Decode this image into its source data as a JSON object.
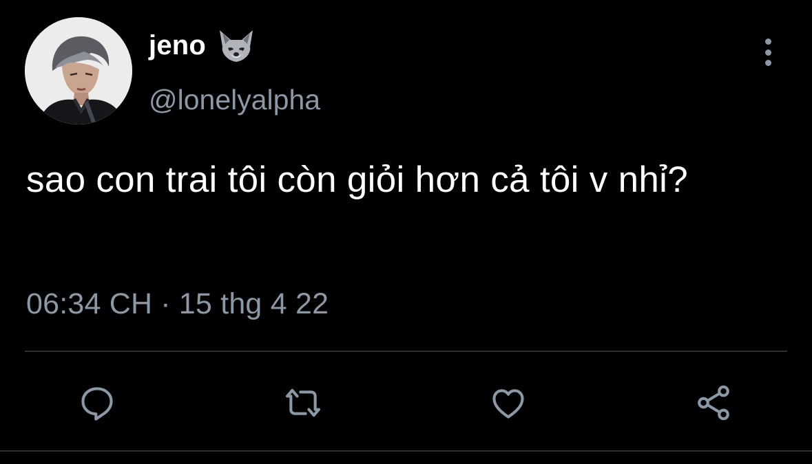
{
  "author": {
    "display_name": "jeno",
    "emoji": "wolf-emoji",
    "handle": "@lonelyalpha",
    "avatar": "profile-photo"
  },
  "tweet": {
    "text": "sao con trai tôi còn giỏi hơn cả tôi v nhỉ?",
    "time": "06:34 CH",
    "separator": "·",
    "date": "15 thg 4 22"
  },
  "actions": {
    "reply": "reply-icon",
    "retweet": "retweet-icon",
    "like": "heart-icon",
    "share": "share-icon",
    "more": "more-vertical-icon"
  },
  "colors": {
    "background": "#000000",
    "text": "#ffffff",
    "secondary_text": "#8b98a5",
    "divider": "#2f3336"
  }
}
